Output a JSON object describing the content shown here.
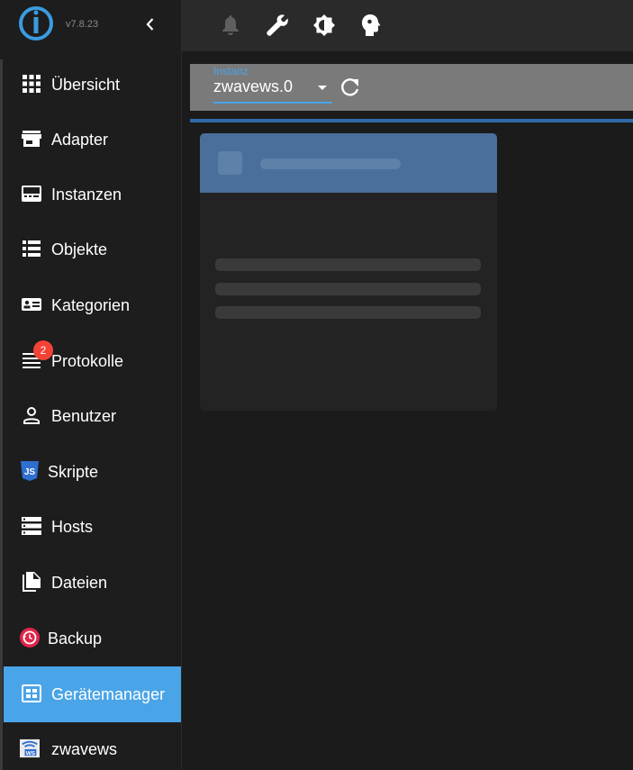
{
  "sidebar": {
    "version": "v7.8.23",
    "items": [
      {
        "label": "Übersicht",
        "icon": "grid-icon"
      },
      {
        "label": "Adapter",
        "icon": "store-icon"
      },
      {
        "label": "Instanzen",
        "icon": "instances-icon"
      },
      {
        "label": "Objekte",
        "icon": "list-icon"
      },
      {
        "label": "Kategorien",
        "icon": "category-icon"
      },
      {
        "label": "Protokolle",
        "icon": "log-icon",
        "badge": "2"
      },
      {
        "label": "Benutzer",
        "icon": "user-icon"
      },
      {
        "label": "Skripte",
        "icon": "js-icon"
      },
      {
        "label": "Hosts",
        "icon": "hosts-icon"
      },
      {
        "label": "Dateien",
        "icon": "files-icon"
      },
      {
        "label": "Backup",
        "icon": "backup-icon"
      },
      {
        "label": "Gerätemanager",
        "icon": "device-manager-icon",
        "active": true
      },
      {
        "label": "zwavews",
        "icon": "zwavews-icon"
      }
    ]
  },
  "topbar": {
    "icons": [
      "bell-icon",
      "wrench-icon",
      "theme-icon",
      "expert-mode-icon"
    ]
  },
  "instance": {
    "label": "Instanz",
    "value": "zwavews.0"
  },
  "colors": {
    "accent": "#4aa4e8",
    "badge": "#f44336",
    "card_header": "#4a6f9a"
  }
}
